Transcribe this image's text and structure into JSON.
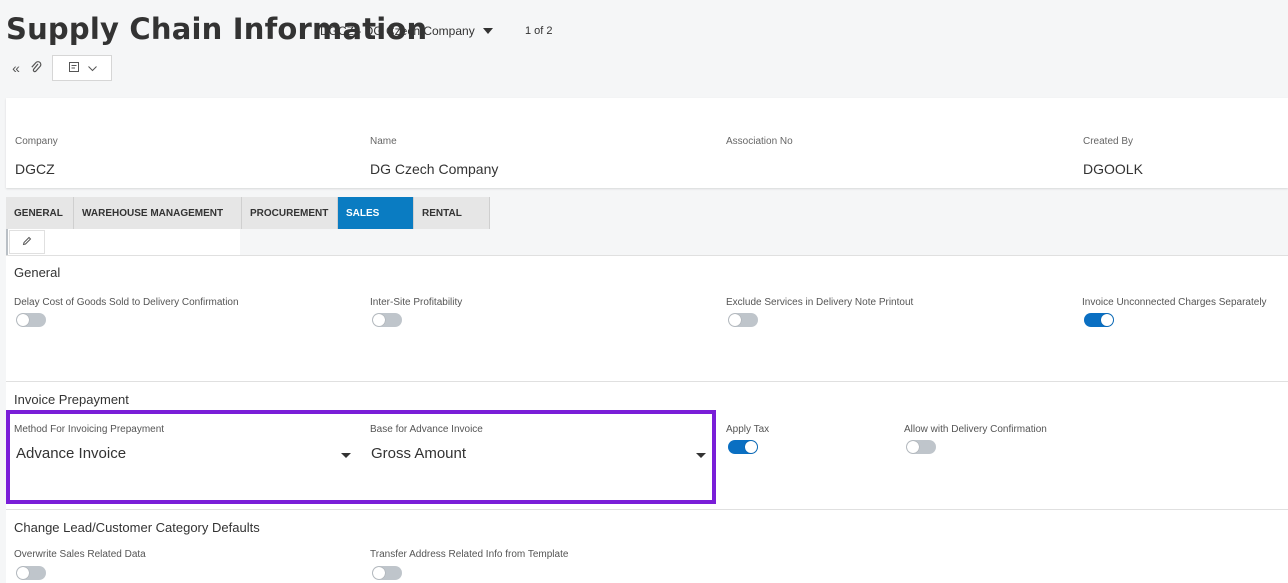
{
  "header": {
    "title": "Supply Chain Information",
    "context": "DGCZ - DG Czech Company",
    "pager": "1 of 2",
    "toolbar": {
      "collapse_icon": "double-chevron-left-icon",
      "attach_icon": "paperclip-icon",
      "notes_icon": "notes-icon"
    }
  },
  "record": {
    "company_label": "Company",
    "company_value": "DGCZ",
    "name_label": "Name",
    "name_value": "DG Czech Company",
    "association_label": "Association No",
    "association_value": "",
    "created_label": "Created By",
    "created_value": "DGOOLK"
  },
  "tabs": [
    "GENERAL",
    "WAREHOUSE MANAGEMENT",
    "PROCUREMENT",
    "SALES",
    "RENTAL"
  ],
  "active_tab": "SALES",
  "general": {
    "title": "General",
    "fields": [
      {
        "label": "Delay Cost of Goods Sold to Delivery Confirmation",
        "on": false
      },
      {
        "label": "Inter-Site Profitability",
        "on": false
      },
      {
        "label": "Exclude Services in Delivery Note Printout",
        "on": false
      },
      {
        "label": "Invoice Unconnected Charges Separately",
        "on": true
      }
    ]
  },
  "prepayment": {
    "title": "Invoice Prepayment",
    "method_label": "Method For Invoicing Prepayment",
    "method_value": "Advance Invoice",
    "base_label": "Base for Advance Invoice",
    "base_value": "Gross Amount",
    "apply_tax_label": "Apply Tax",
    "apply_tax_on": true,
    "allow_label": "Allow with Delivery Confirmation",
    "allow_on": false
  },
  "change_defaults": {
    "title": "Change Lead/Customer Category Defaults",
    "overwrite_label": "Overwrite Sales Related Data",
    "overwrite_on": false,
    "transfer_label": "Transfer Address Related Info from Template",
    "transfer_on": false
  },
  "colors": {
    "accent": "#0a7cc2",
    "toggle_on": "#0a6fc2",
    "highlight": "#7a1ed8"
  }
}
